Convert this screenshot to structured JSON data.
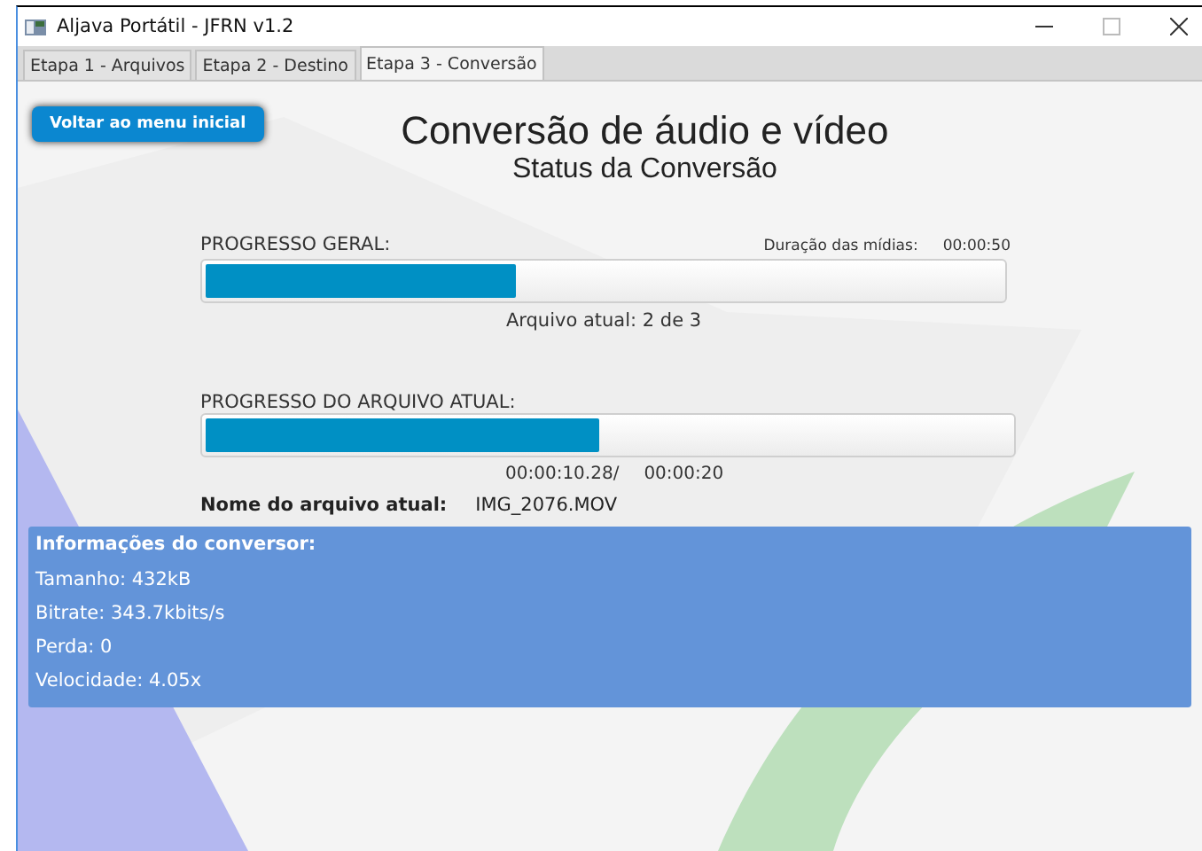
{
  "window": {
    "title": "Aljava Portátil - JFRN v1.2"
  },
  "tabs": [
    {
      "label": "Etapa 1 - Arquivos",
      "selected": false
    },
    {
      "label": "Etapa 2 - Destino",
      "selected": false
    },
    {
      "label": "Etapa 3 - Conversão",
      "selected": true
    }
  ],
  "back_button": "Voltar ao menu inicial",
  "title": "Conversão de áudio e vídeo",
  "subtitle": "Status da Conversão",
  "overall": {
    "label": "PROGRESSO GERAL:",
    "duration_label": "Duração das mídias:",
    "duration": "00:00:50",
    "level": 0.39,
    "caption": "Arquivo atual: 2 de 3"
  },
  "file": {
    "label": "PROGRESSO DO ARQUIVO ATUAL:",
    "level": 0.49,
    "elapsed": "00:00:10.28/",
    "total": "00:00:20",
    "name_label": "Nome do arquivo atual:",
    "name": "IMG_2076.MOV"
  },
  "info": {
    "heading": "Informações do conversor:",
    "lines": [
      "Tamanho: 432kB",
      "Bitrate: 343.7kbits/s",
      "Perda: 0",
      "Velocidade: 4.05x"
    ]
  }
}
